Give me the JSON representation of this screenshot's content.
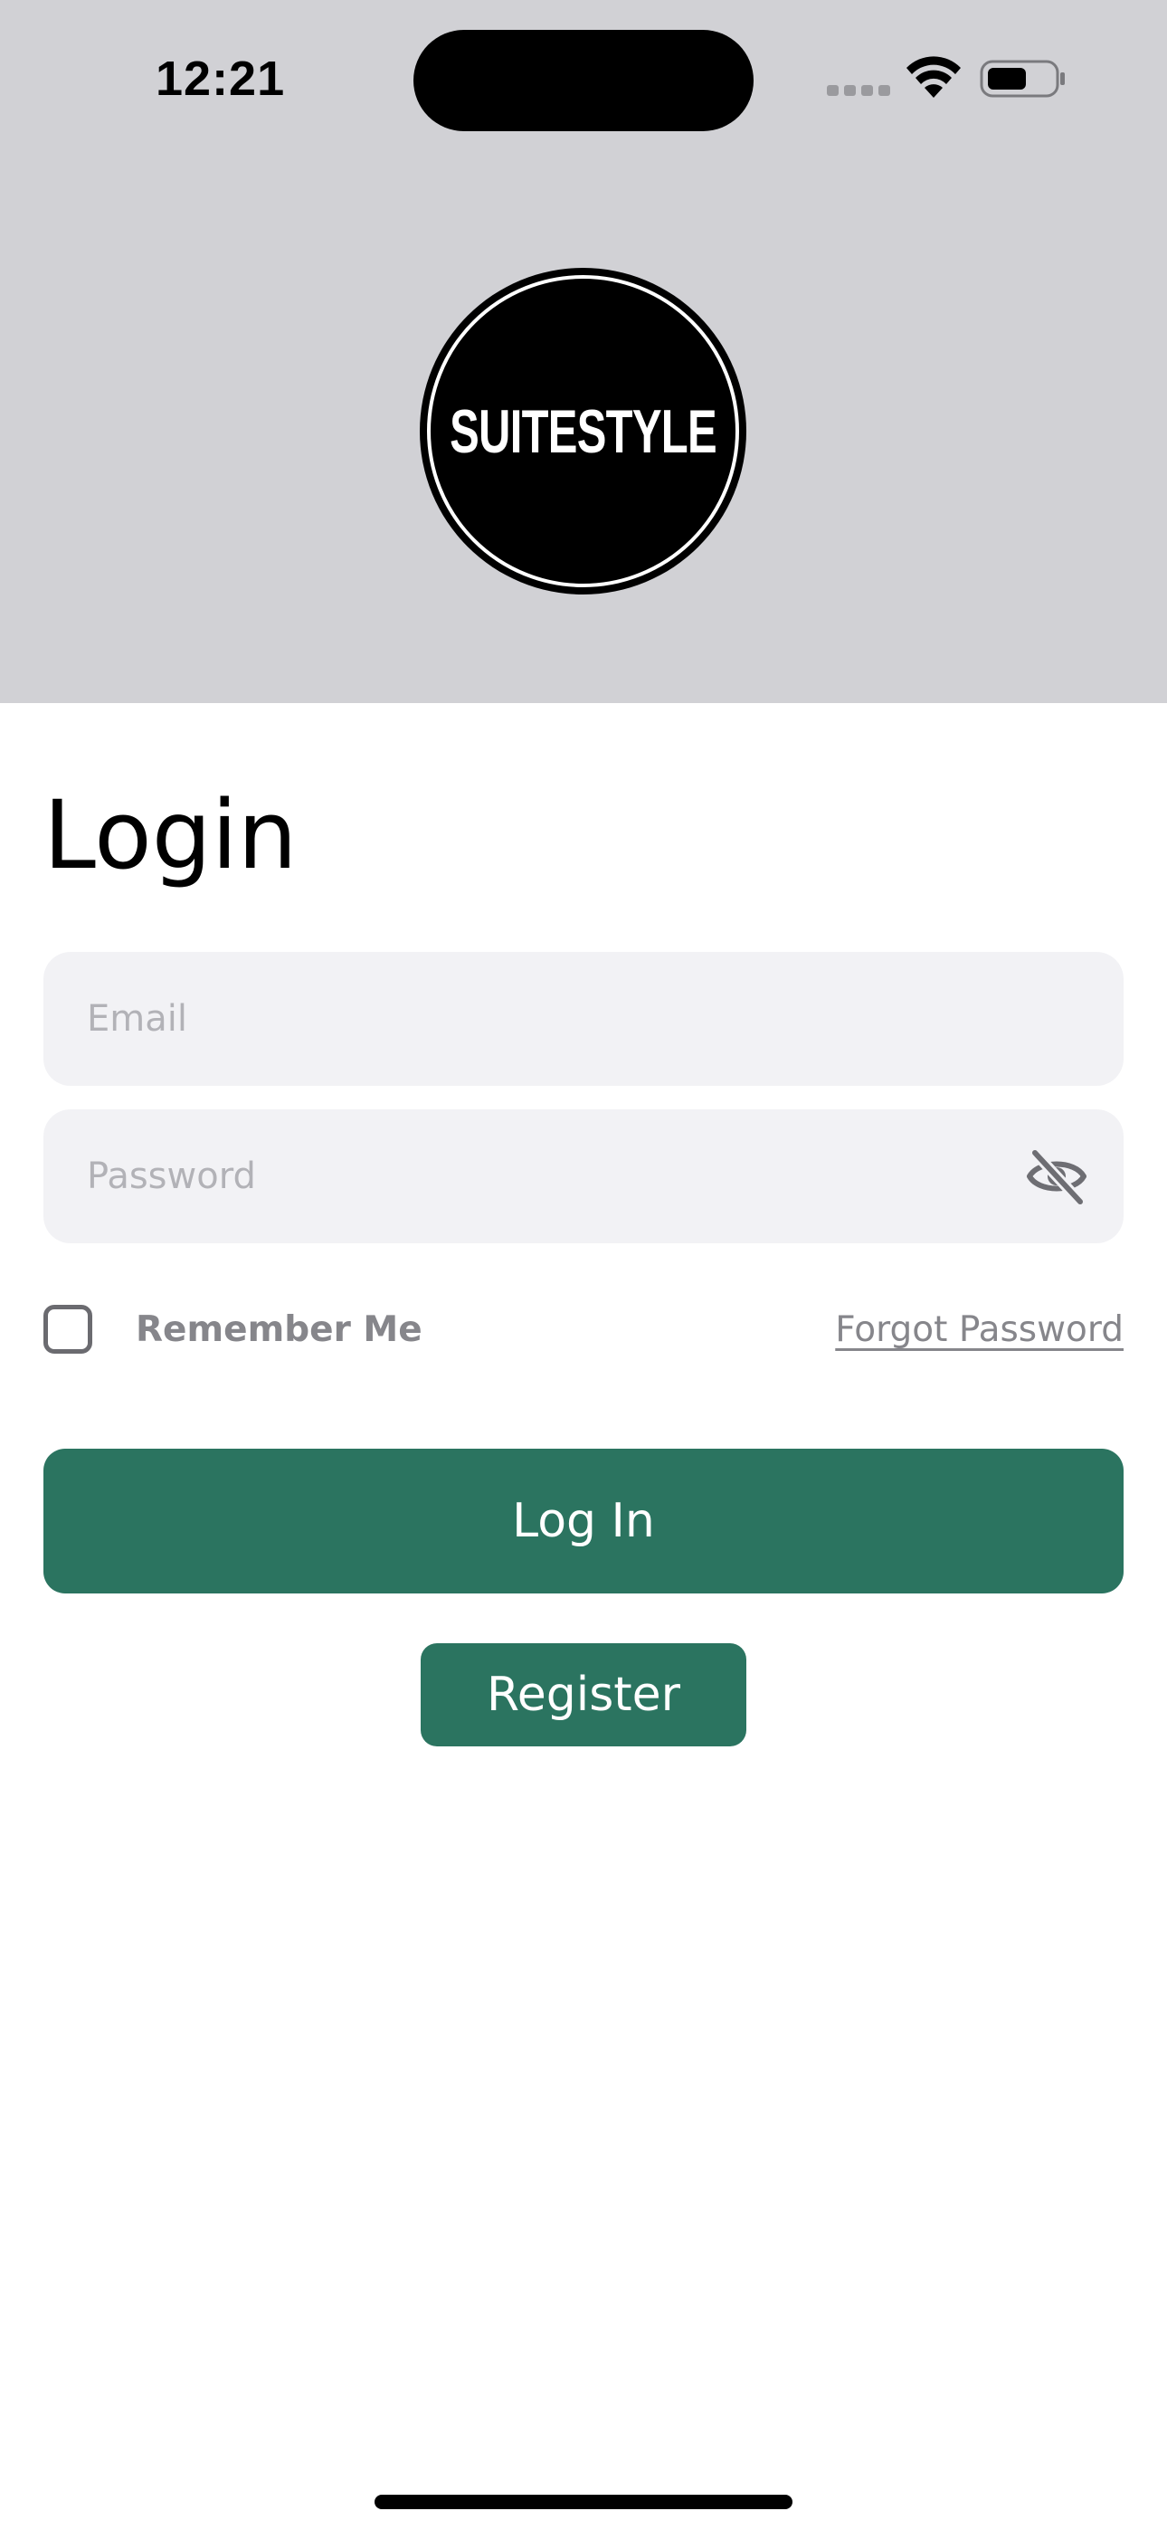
{
  "status_bar": {
    "time": "12:21",
    "signal_icon": "cellular-signal-icon",
    "wifi_icon": "wifi-icon",
    "battery_icon": "battery-icon",
    "battery_level": 0.55
  },
  "header": {
    "logo_text": "SUITESTYLE",
    "background_color": "#d1d1d5"
  },
  "form": {
    "title": "Login",
    "email": {
      "value": "",
      "placeholder": "Email"
    },
    "password": {
      "value": "",
      "placeholder": "Password",
      "toggle_icon": "eye-slash-icon"
    },
    "remember_me": {
      "label": "Remember Me",
      "checked": false
    },
    "forgot_password_label": "Forgot Password",
    "login_button_label": "Log In",
    "register_button_label": "Register"
  },
  "colors": {
    "accent": "#2b7460",
    "field_background": "#f2f2f5",
    "muted_text": "#86868b"
  }
}
